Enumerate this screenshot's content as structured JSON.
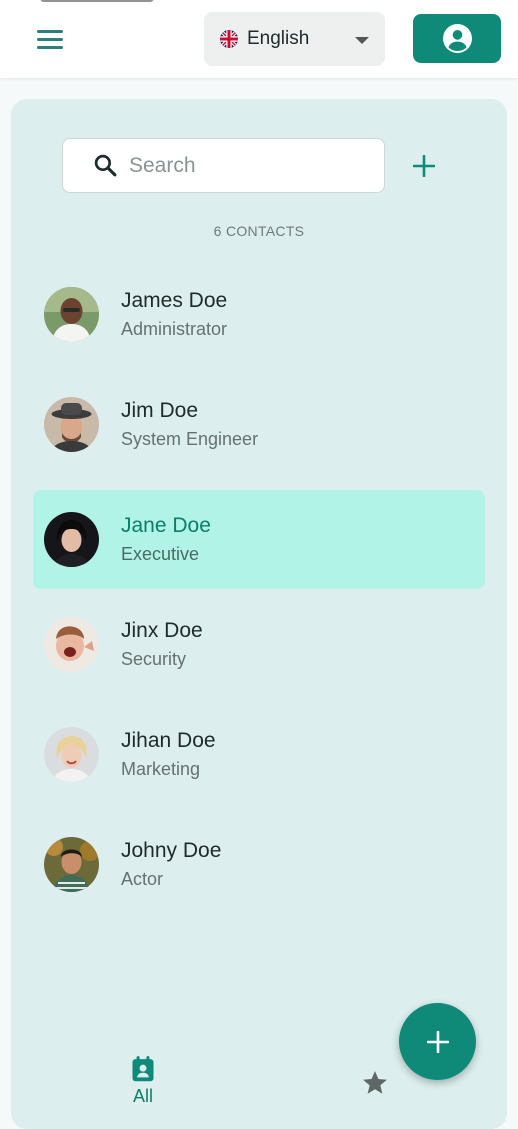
{
  "header": {
    "language": {
      "selected": "English",
      "flag_icon": "uk-flag-icon"
    },
    "menu_icon": "hamburger-menu-icon",
    "account_icon": "user-circle-icon"
  },
  "search": {
    "placeholder": "Search",
    "value": ""
  },
  "contacts_count_label": "6 CONTACTS",
  "contacts": [
    {
      "name": "James Doe",
      "role": "Administrator",
      "selected": false
    },
    {
      "name": "Jim Doe",
      "role": "System Engineer",
      "selected": false
    },
    {
      "name": "Jane Doe",
      "role": "Executive",
      "selected": true
    },
    {
      "name": "Jinx Doe",
      "role": "Security",
      "selected": false
    },
    {
      "name": "Jihan Doe",
      "role": "Marketing",
      "selected": false
    },
    {
      "name": "Johny Doe",
      "role": "Actor",
      "selected": false
    }
  ],
  "bottom_nav": {
    "all_label": "All",
    "all_icon": "contacts-calendar-icon",
    "favorites_icon": "star-icon"
  },
  "colors": {
    "primary": "#0f8a78",
    "panel": "#dceeed",
    "selected_row": "#b1f3e7"
  }
}
